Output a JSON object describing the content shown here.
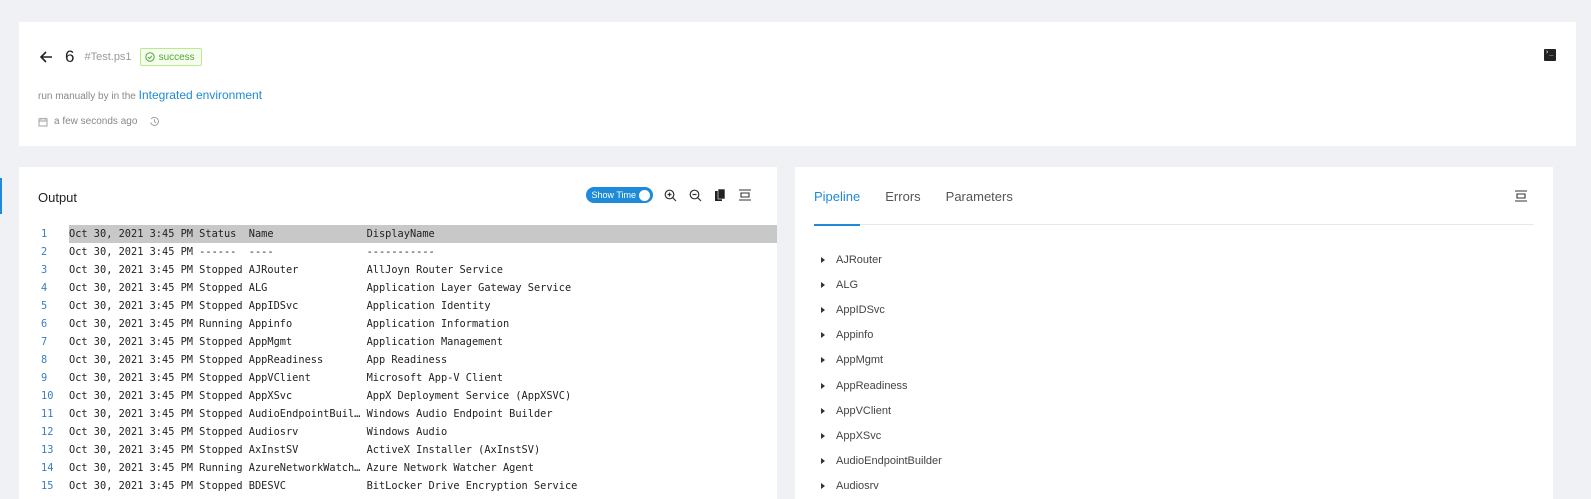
{
  "header": {
    "run_number": "6",
    "script_tag": "#Test.ps1",
    "status": "success",
    "meta_prefix": "run manually by in the",
    "environment_link": "Integrated environment",
    "time_ago": "a few seconds ago"
  },
  "output": {
    "title": "Output",
    "show_time_label": "Show Time",
    "lines": [
      {
        "n": "1",
        "text": "Oct 30, 2021 3:45 PM Status  Name               DisplayName"
      },
      {
        "n": "2",
        "text": "Oct 30, 2021 3:45 PM ------  ----               -----------"
      },
      {
        "n": "3",
        "text": "Oct 30, 2021 3:45 PM Stopped AJRouter           AllJoyn Router Service"
      },
      {
        "n": "4",
        "text": "Oct 30, 2021 3:45 PM Stopped ALG                Application Layer Gateway Service"
      },
      {
        "n": "5",
        "text": "Oct 30, 2021 3:45 PM Stopped AppIDSvc           Application Identity"
      },
      {
        "n": "6",
        "text": "Oct 30, 2021 3:45 PM Running Appinfo            Application Information"
      },
      {
        "n": "7",
        "text": "Oct 30, 2021 3:45 PM Stopped AppMgmt            Application Management"
      },
      {
        "n": "8",
        "text": "Oct 30, 2021 3:45 PM Stopped AppReadiness       App Readiness"
      },
      {
        "n": "9",
        "text": "Oct 30, 2021 3:45 PM Stopped AppVClient         Microsoft App-V Client"
      },
      {
        "n": "10",
        "text": "Oct 30, 2021 3:45 PM Stopped AppXSvc            AppX Deployment Service (AppXSVC)"
      },
      {
        "n": "11",
        "text": "Oct 30, 2021 3:45 PM Stopped AudioEndpointBuil… Windows Audio Endpoint Builder"
      },
      {
        "n": "12",
        "text": "Oct 30, 2021 3:45 PM Stopped Audiosrv           Windows Audio"
      },
      {
        "n": "13",
        "text": "Oct 30, 2021 3:45 PM Stopped AxInstSV           ActiveX Installer (AxInstSV)"
      },
      {
        "n": "14",
        "text": "Oct 30, 2021 3:45 PM Running AzureNetworkWatch… Azure Network Watcher Agent"
      },
      {
        "n": "15",
        "text": "Oct 30, 2021 3:45 PM Stopped BDESVC             BitLocker Drive Encryption Service"
      }
    ]
  },
  "pipeline": {
    "tabs": [
      "Pipeline",
      "Errors",
      "Parameters"
    ],
    "active_tab": "Pipeline",
    "items": [
      "AJRouter",
      "ALG",
      "AppIDSvc",
      "Appinfo",
      "AppMgmt",
      "AppReadiness",
      "AppVClient",
      "AppXSvc",
      "AudioEndpointBuilder",
      "Audiosrv"
    ]
  },
  "colors": {
    "accent": "#1f8ad8",
    "success": "#52a43a",
    "highlight_row": "#c8c8c8"
  },
  "icons": [
    "arrow-left-icon",
    "check-circle-icon",
    "calendar-icon",
    "history-icon",
    "terminal-icon",
    "zoom-in-icon",
    "zoom-out-icon",
    "copy-icon",
    "wrap-icon"
  ]
}
